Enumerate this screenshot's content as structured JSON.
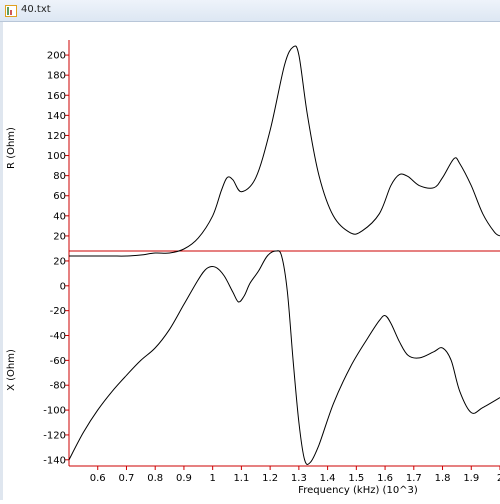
{
  "window": {
    "title": "40.txt",
    "icon": "text-file-icon"
  },
  "chart_data": [
    {
      "type": "line",
      "title": "",
      "ylabel": "R (Ohm)",
      "xlabel": "",
      "xlim": [
        0.5,
        2.0
      ],
      "ylim": [
        5,
        215
      ],
      "yticks": [
        20,
        40,
        60,
        80,
        100,
        120,
        140,
        160,
        180,
        200
      ],
      "grid": false,
      "series": [
        {
          "color": "#000000",
          "points": [
            [
              0.5,
              0
            ],
            [
              0.55,
              0
            ],
            [
              0.6,
              0
            ],
            [
              0.65,
              0
            ],
            [
              0.7,
              0
            ],
            [
              0.75,
              1
            ],
            [
              0.8,
              3
            ],
            [
              0.85,
              3
            ],
            [
              0.9,
              7
            ],
            [
              0.95,
              18
            ],
            [
              1.0,
              40
            ],
            [
              1.03,
              65
            ],
            [
              1.05,
              78
            ],
            [
              1.07,
              76
            ],
            [
              1.1,
              64
            ],
            [
              1.15,
              78
            ],
            [
              1.2,
              125
            ],
            [
              1.25,
              190
            ],
            [
              1.28,
              208
            ],
            [
              1.3,
              200
            ],
            [
              1.33,
              140
            ],
            [
              1.37,
              80
            ],
            [
              1.42,
              40
            ],
            [
              1.48,
              23
            ],
            [
              1.52,
              25
            ],
            [
              1.58,
              42
            ],
            [
              1.62,
              70
            ],
            [
              1.65,
              81
            ],
            [
              1.68,
              79
            ],
            [
              1.72,
              70
            ],
            [
              1.77,
              68
            ],
            [
              1.8,
              78
            ],
            [
              1.84,
              97
            ],
            [
              1.86,
              92
            ],
            [
              1.9,
              70
            ],
            [
              1.94,
              42
            ],
            [
              1.98,
              24
            ],
            [
              2.0,
              20
            ]
          ]
        }
      ]
    },
    {
      "type": "line",
      "title": "",
      "ylabel": "X (Ohm)",
      "xlabel": "Frequency (kHz) (10^3)",
      "xlim": [
        0.5,
        2.0
      ],
      "ylim": [
        -145,
        28
      ],
      "yticks": [
        -140,
        -120,
        -100,
        -80,
        -60,
        -40,
        -20,
        0,
        20
      ],
      "xticks": [
        0.6,
        0.7,
        0.8,
        0.9,
        1.0,
        1.1,
        1.2,
        1.3,
        1.4,
        1.5,
        1.6,
        1.7,
        1.8,
        1.9,
        2
      ],
      "grid": false,
      "series": [
        {
          "color": "#000000",
          "points": [
            [
              0.5,
              -140
            ],
            [
              0.55,
              -118
            ],
            [
              0.6,
              -100
            ],
            [
              0.65,
              -85
            ],
            [
              0.7,
              -72
            ],
            [
              0.75,
              -60
            ],
            [
              0.8,
              -50
            ],
            [
              0.85,
              -35
            ],
            [
              0.9,
              -15
            ],
            [
              0.95,
              5
            ],
            [
              0.98,
              14
            ],
            [
              1.01,
              15
            ],
            [
              1.04,
              8
            ],
            [
              1.07,
              -5
            ],
            [
              1.09,
              -13
            ],
            [
              1.11,
              -8
            ],
            [
              1.13,
              2
            ],
            [
              1.16,
              12
            ],
            [
              1.19,
              24
            ],
            [
              1.22,
              28
            ],
            [
              1.24,
              24
            ],
            [
              1.26,
              -5
            ],
            [
              1.28,
              -60
            ],
            [
              1.3,
              -110
            ],
            [
              1.32,
              -140
            ],
            [
              1.34,
              -142
            ],
            [
              1.37,
              -128
            ],
            [
              1.42,
              -95
            ],
            [
              1.48,
              -65
            ],
            [
              1.54,
              -42
            ],
            [
              1.58,
              -28
            ],
            [
              1.6,
              -24
            ],
            [
              1.62,
              -30
            ],
            [
              1.65,
              -45
            ],
            [
              1.68,
              -56
            ],
            [
              1.72,
              -58
            ],
            [
              1.77,
              -53
            ],
            [
              1.8,
              -50
            ],
            [
              1.83,
              -60
            ],
            [
              1.86,
              -85
            ],
            [
              1.9,
              -102
            ],
            [
              1.94,
              -98
            ],
            [
              2.0,
              -90
            ]
          ]
        }
      ]
    }
  ],
  "colors": {
    "axis": "#cc0000",
    "line": "#000000",
    "titlebar": "#dde7f3"
  }
}
